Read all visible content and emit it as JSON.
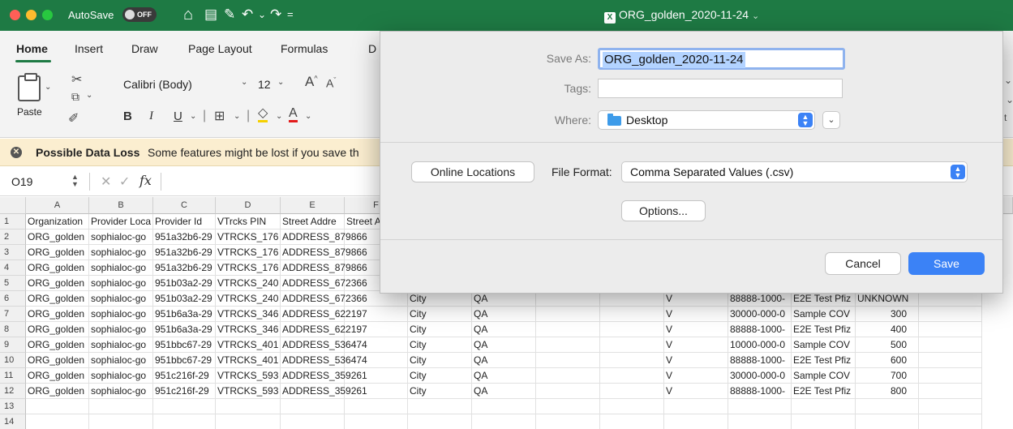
{
  "titlebar": {
    "autosave_label": "AutoSave",
    "autosave_state": "OFF",
    "doc_title": "ORG_golden_2020-11-24",
    "doc_title_chevron": "⌄",
    "quick_access_icons": [
      "home-icon",
      "save-icon",
      "edit-icon",
      "undo-icon",
      "redo-icon",
      "customize-icon"
    ]
  },
  "ribbon": {
    "tabs": [
      "Home",
      "Insert",
      "Draw",
      "Page Layout",
      "Formulas",
      "D"
    ],
    "paste_label": "Paste",
    "font_name": "Calibri (Body)",
    "font_size": "12",
    "format_buttons": [
      "B",
      "I",
      "U"
    ]
  },
  "warning": {
    "title": "Possible Data Loss",
    "text": "Some features might be lost if you save th"
  },
  "formula_bar": {
    "cell_ref": "O19",
    "fx": "fx"
  },
  "grid": {
    "columns": [
      "A",
      "B",
      "C",
      "D",
      "E",
      "F"
    ],
    "rows": [
      {
        "num": "1",
        "cells": [
          "Organization",
          "Provider Loca",
          "Provider Id",
          "VTrcks PIN",
          "Street Addre",
          "Street A",
          "",
          "",
          "",
          "",
          "",
          "",
          "",
          "",
          ""
        ]
      },
      {
        "num": "2",
        "cells": [
          "ORG_golden",
          "sophialoc-go",
          "951a32b6-29",
          "VTRCKS_176",
          "ADDRESS_879866",
          "",
          "",
          "",
          "",
          "",
          "",
          "",
          "",
          "",
          ""
        ]
      },
      {
        "num": "3",
        "cells": [
          "ORG_golden",
          "sophialoc-go",
          "951a32b6-29",
          "VTRCKS_176",
          "ADDRESS_879866",
          "",
          "",
          "",
          "",
          "",
          "",
          "",
          "",
          "",
          ""
        ]
      },
      {
        "num": "4",
        "cells": [
          "ORG_golden",
          "sophialoc-go",
          "951a32b6-29",
          "VTRCKS_176",
          "ADDRESS_879866",
          "",
          "",
          "",
          "",
          "",
          "",
          "",
          "",
          "",
          ""
        ]
      },
      {
        "num": "5",
        "cells": [
          "ORG_golden",
          "sophialoc-go",
          "951b03a2-29",
          "VTRCKS_240",
          "ADDRESS_672366",
          "",
          "",
          "",
          "",
          "",
          "",
          "",
          "",
          "",
          ""
        ]
      },
      {
        "num": "6",
        "cells": [
          "ORG_golden",
          "sophialoc-go",
          "951b03a2-29",
          "VTRCKS_240",
          "ADDRESS_672366",
          "",
          "City",
          "QA",
          "",
          "",
          "V",
          "88888-1000-",
          "E2E Test Pfiz",
          "UNKNOWN",
          ""
        ]
      },
      {
        "num": "7",
        "cells": [
          "ORG_golden",
          "sophialoc-go",
          "951b6a3a-29",
          "VTRCKS_346",
          "ADDRESS_622197",
          "",
          "City",
          "QA",
          "",
          "",
          "V",
          "30000-000-0",
          "Sample COV",
          "300",
          ""
        ]
      },
      {
        "num": "8",
        "cells": [
          "ORG_golden",
          "sophialoc-go",
          "951b6a3a-29",
          "VTRCKS_346",
          "ADDRESS_622197",
          "",
          "City",
          "QA",
          "",
          "",
          "V",
          "88888-1000-",
          "E2E Test Pfiz",
          "400",
          ""
        ]
      },
      {
        "num": "9",
        "cells": [
          "ORG_golden",
          "sophialoc-go",
          "951bbc67-29",
          "VTRCKS_401",
          "ADDRESS_536474",
          "",
          "City",
          "QA",
          "",
          "",
          "V",
          "10000-000-0",
          "Sample COV",
          "500",
          ""
        ]
      },
      {
        "num": "10",
        "cells": [
          "ORG_golden",
          "sophialoc-go",
          "951bbc67-29",
          "VTRCKS_401",
          "ADDRESS_536474",
          "",
          "City",
          "QA",
          "",
          "",
          "V",
          "88888-1000-",
          "E2E Test Pfiz",
          "600",
          ""
        ]
      },
      {
        "num": "11",
        "cells": [
          "ORG_golden",
          "sophialoc-go",
          "951c216f-29",
          "VTRCKS_593",
          "ADDRESS_359261",
          "",
          "City",
          "QA",
          "",
          "",
          "V",
          "30000-000-0",
          "Sample COV",
          "700",
          ""
        ]
      },
      {
        "num": "12",
        "cells": [
          "ORG_golden",
          "sophialoc-go",
          "951c216f-29",
          "VTRCKS_593",
          "ADDRESS_359261",
          "",
          "City",
          "QA",
          "",
          "",
          "V",
          "88888-1000-",
          "E2E Test Pfiz",
          "800",
          ""
        ]
      },
      {
        "num": "13",
        "cells": [
          "",
          "",
          "",
          "",
          "",
          "",
          "",
          "",
          "",
          "",
          "",
          "",
          "",
          "",
          ""
        ]
      },
      {
        "num": "14",
        "cells": [
          "",
          "",
          "",
          "",
          "",
          "",
          "",
          "",
          "",
          "",
          "",
          "",
          "",
          "",
          ""
        ]
      }
    ]
  },
  "dialog": {
    "save_as_label": "Save As:",
    "save_as_value": "ORG_golden_2020-11-24",
    "tags_label": "Tags:",
    "tags_value": "",
    "where_label": "Where:",
    "where_value": "Desktop",
    "online_locations": "Online Locations",
    "file_format_label": "File Format:",
    "file_format_value": "Comma Separated Values (.csv)",
    "options": "Options...",
    "cancel": "Cancel",
    "save": "Save"
  },
  "colors": {
    "titlebar": "#1e7a44",
    "accent_blue": "#3b82f6",
    "warning_bg": "#fbeed0"
  }
}
